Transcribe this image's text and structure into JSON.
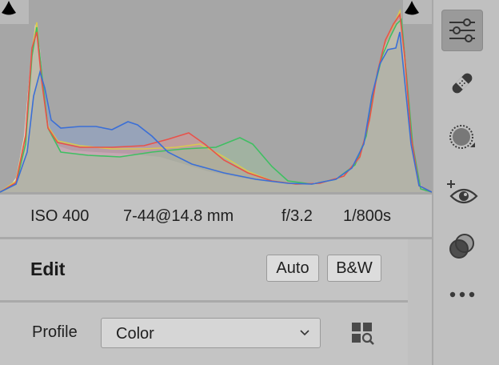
{
  "histogram": {
    "icons": {
      "left": "shadow-clipping-triangle-icon",
      "right": "highlight-clipping-triangle-icon"
    }
  },
  "exif": {
    "iso": "ISO 400",
    "focal_length": "7-44@14.8 mm",
    "aperture": "f/3.2",
    "shutter": "1/800s"
  },
  "edit": {
    "title": "Edit",
    "auto_label": "Auto",
    "bw_label": "B&W"
  },
  "profile": {
    "label": "Profile",
    "value": "Color",
    "browse_icon": "profile-browser-grid-icon"
  },
  "toolbar": {
    "active": "edit",
    "tools": [
      "sliders-icon",
      "bandage-icon",
      "masking-icon",
      "red-eye-icon",
      "presets-icon",
      "more-icon"
    ]
  },
  "colors": {
    "histogram_bg": "#a6a6a6",
    "panel_bg": "#c4c4c4",
    "red": "#e8524a",
    "green": "#3fbf62",
    "blue": "#3b6fd6",
    "yellow": "#d8c850"
  }
}
